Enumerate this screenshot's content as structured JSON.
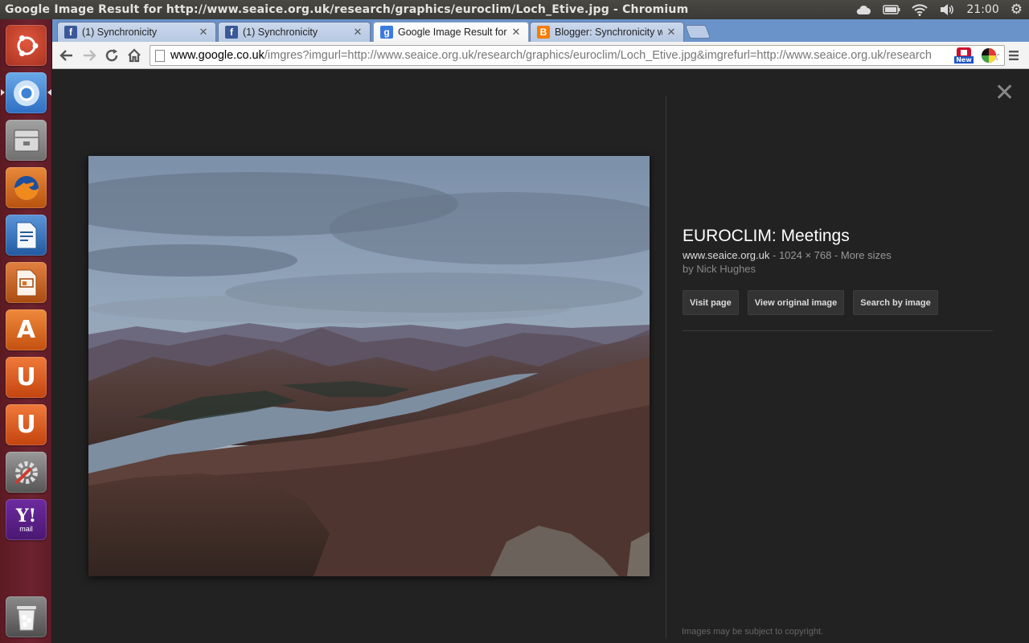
{
  "window": {
    "title": "Google Image Result for http://www.seaice.org.uk/research/graphics/euroclim/Loch_Etive.jpg - Chromium",
    "clock": "21:00"
  },
  "indicators": [
    "cloud-icon",
    "battery-icon",
    "wifi-icon",
    "volume-icon",
    "gear-icon"
  ],
  "launcher": {
    "items": [
      {
        "name": "ubuntu-dash",
        "color": "#c9432d"
      },
      {
        "name": "chromium",
        "color": "#3a7bc8"
      },
      {
        "name": "file-manager",
        "color": "#9a9a9a"
      },
      {
        "name": "firefox",
        "color": "#e0701c"
      },
      {
        "name": "libreoffice-writer",
        "color": "#2d6db3"
      },
      {
        "name": "libreoffice-impress",
        "color": "#c95a1a"
      },
      {
        "name": "ubuntu-software-center",
        "color": "#e06a1b"
      },
      {
        "name": "ubuntu-one",
        "color": "#e0501b"
      },
      {
        "name": "ubuntu-one-music",
        "color": "#e0501b"
      },
      {
        "name": "system-settings",
        "color": "#777777"
      },
      {
        "name": "yahoo-mail",
        "color": "#5c1f8a"
      },
      {
        "name": "trash",
        "color": "#7a7a7a"
      }
    ],
    "yahoo_text": "Y!",
    "yahoo_sub": "mail",
    "software_letter": "A",
    "u_letter": "U"
  },
  "tabs": [
    {
      "label": "(1) Synchronicity",
      "icon": "facebook-icon",
      "color": "#3b5998",
      "active": false
    },
    {
      "label": "(1) Synchronicity",
      "icon": "facebook-icon",
      "color": "#3b5998",
      "active": false
    },
    {
      "label": "Google Image Result for h",
      "icon": "google-icon",
      "color": "#3b7be0",
      "active": true
    },
    {
      "label": "Blogger: Synchronicity wi",
      "icon": "blogger-icon",
      "color": "#f57d00",
      "active": false
    }
  ],
  "omnibox": {
    "host": "www.google.co.uk",
    "rest": "/imgres?imgurl=http://www.seaice.org.uk/research/graphics/euroclim/Loch_Etive.jpg&imgrefurl=http://www.seaice.org.uk/research"
  },
  "extensions": {
    "new_badge": "New"
  },
  "result": {
    "title": "EUROCLIM: Meetings",
    "site": "www.seaice.org.uk",
    "dimensions": " - 1024 × 768 - More sizes",
    "byline": "by Nick Hughes",
    "buttons": [
      "Visit page",
      "View original image",
      "Search by image"
    ],
    "copyright": "Images may be subject to copyright."
  }
}
